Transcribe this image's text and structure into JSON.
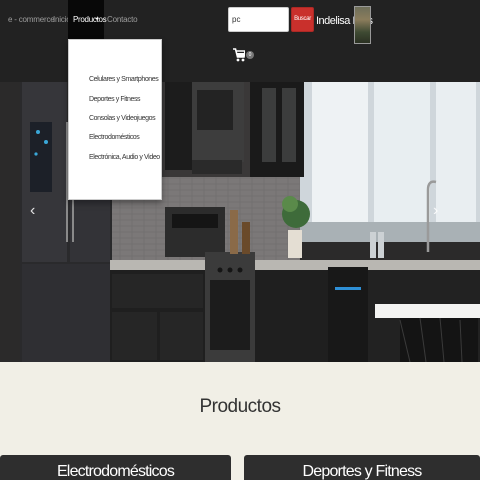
{
  "navbar": {
    "brand": "e - commerce",
    "links": {
      "inicio": "Inicio",
      "productos": "Productos",
      "contacto": "Contacto"
    },
    "search": {
      "value": "pc",
      "button": "Buscar"
    },
    "user": {
      "name": "Indelisa Rios"
    },
    "cart": {
      "icon": "shopping-cart-icon",
      "count": "0"
    }
  },
  "dropdown": {
    "items": [
      "Celulares y Smartphones",
      "Deportes y Fitness",
      "Consolas y Videojuegos",
      "Electrodomésticos",
      "Electrónica, Audio y Video"
    ]
  },
  "carousel": {
    "prev_icon": "chevron-left-icon",
    "next_icon": "chevron-right-icon",
    "prev": "‹",
    "next": "›"
  },
  "section": {
    "title": "Productos",
    "cards": [
      "Electrodomésticos",
      "Deportes y Fitness"
    ]
  },
  "colors": {
    "navbar": "#222222",
    "search_button": "#c9302c",
    "page_bg": "#f1efe6"
  }
}
